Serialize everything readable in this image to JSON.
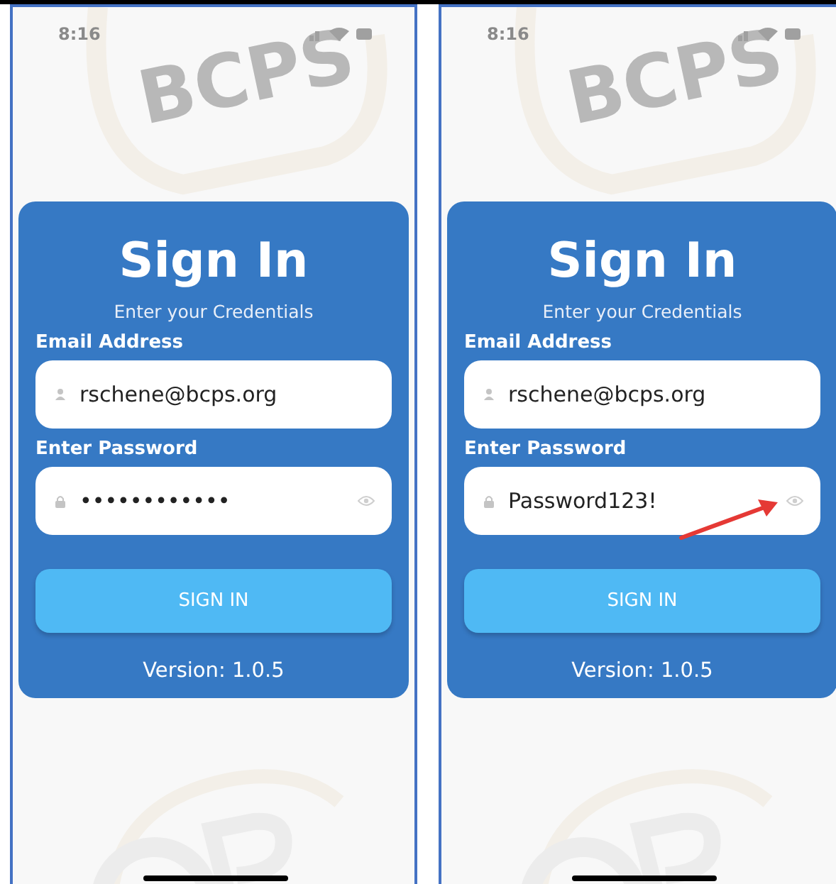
{
  "screens": [
    {
      "status_time": "8:16",
      "logo_text": "BCPS",
      "title": "Sign In",
      "subtitle": "Enter your Credentials",
      "email_label": "Email Address",
      "email_value": "rschene@bcps.org",
      "password_label": "Enter Password",
      "password_value": "••••••••••••",
      "button": "SIGN IN",
      "version": "Version: 1.0.5",
      "arrow": false
    },
    {
      "status_time": "8:16",
      "logo_text": "BCPS",
      "title": "Sign In",
      "subtitle": "Enter your Credentials",
      "email_label": "Email Address",
      "email_value": "rschene@bcps.org",
      "password_label": "Enter Password",
      "password_value": "Password123!",
      "button": "SIGN IN",
      "version": "Version: 1.0.5",
      "arrow": true
    }
  ]
}
